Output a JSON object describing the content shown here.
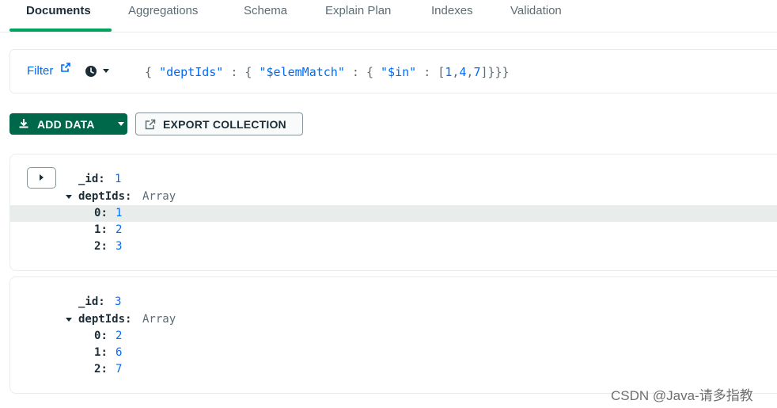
{
  "tabs": [
    {
      "label": "Documents",
      "active": true
    },
    {
      "label": "Aggregations",
      "active": false
    },
    {
      "label": "Schema",
      "active": false
    },
    {
      "label": "Explain Plan",
      "active": false
    },
    {
      "label": "Indexes",
      "active": false
    },
    {
      "label": "Validation",
      "active": false
    }
  ],
  "filter": {
    "label": "Filter",
    "query_parts": {
      "p1": "{ ",
      "s1": "\"deptIds\"",
      "p2": " : { ",
      "s2": "\"$elemMatch\"",
      "p3": " : { ",
      "s3": "\"$in\"",
      "p4": " : [",
      "n1": "1",
      "c1": ",",
      "n2": "4",
      "c2": ",",
      "n3": "7",
      "p5": "]}}}"
    }
  },
  "toolbar": {
    "add_data_label": "ADD DATA",
    "export_label": "EXPORT COLLECTION"
  },
  "documents": [
    {
      "id_key": "_id",
      "id_value": "1",
      "array_key": "deptIds",
      "array_type": "Array",
      "items": [
        {
          "index": "0",
          "value": "1"
        },
        {
          "index": "1",
          "value": "2"
        },
        {
          "index": "2",
          "value": "3"
        }
      ]
    },
    {
      "id_key": "_id",
      "id_value": "3",
      "array_key": "deptIds",
      "array_type": "Array",
      "items": [
        {
          "index": "0",
          "value": "2"
        },
        {
          "index": "1",
          "value": "6"
        },
        {
          "index": "2",
          "value": "7"
        }
      ]
    }
  ],
  "watermark": "CSDN @Java-请多指教",
  "colors": {
    "accent_green": "#00a35c",
    "button_green": "#00684a",
    "link_blue": "#016bf8",
    "highlight_row": "#e8edeb"
  }
}
